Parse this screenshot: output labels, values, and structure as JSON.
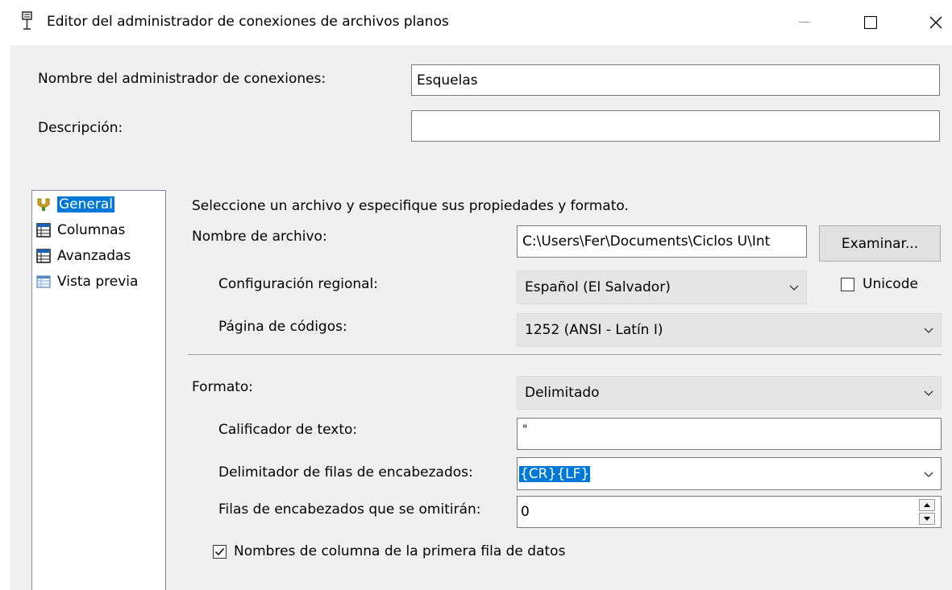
{
  "window": {
    "title": "Editor del administrador de conexiones de archivos planos",
    "minimize_icon": "minimize-icon",
    "maximize_icon": "maximize-icon",
    "close_icon": "close-icon"
  },
  "header": {
    "name_label": "Nombre del administrador de conexiones:",
    "name_value": "Esquelas",
    "description_label": "Descripción:",
    "description_value": ""
  },
  "sidebar": {
    "items": [
      {
        "label": "General",
        "icon": "general-icon",
        "selected": true
      },
      {
        "label": "Columnas",
        "icon": "columns-table-icon"
      },
      {
        "label": "Avanzadas",
        "icon": "advanced-table-icon"
      },
      {
        "label": "Vista previa",
        "icon": "preview-table-icon"
      }
    ]
  },
  "general": {
    "intro": "Seleccione un archivo y especifique sus propiedades y formato.",
    "file_label": "Nombre de archivo:",
    "file_value": "C:\\Users\\Fer\\Documents\\Ciclos U\\Int",
    "browse_label": "Examinar...",
    "locale_label": "Configuración regional:",
    "locale_value": "Español (El Salvador)",
    "unicode_label": "Unicode",
    "unicode_checked": false,
    "codepage_label": "Página de códigos:",
    "codepage_value": "1252  (ANSI - Latín I)",
    "format_label": "Formato:",
    "format_value": "Delimitado",
    "qualifier_label": "Calificador de texto:",
    "qualifier_value": "\"",
    "header_delim_label": "Delimitador de filas de encabezados:",
    "header_delim_value": "{CR}{LF}",
    "skip_rows_label": "Filas de encabezados que se omitirán:",
    "skip_rows_value": "0",
    "column_names_label": "Nombres de columna de la primera fila de datos",
    "column_names_checked": true
  },
  "colors": {
    "selection": "#0078d7",
    "client_bg": "#f0f0f0",
    "combo_bg": "#e5e5e5"
  }
}
